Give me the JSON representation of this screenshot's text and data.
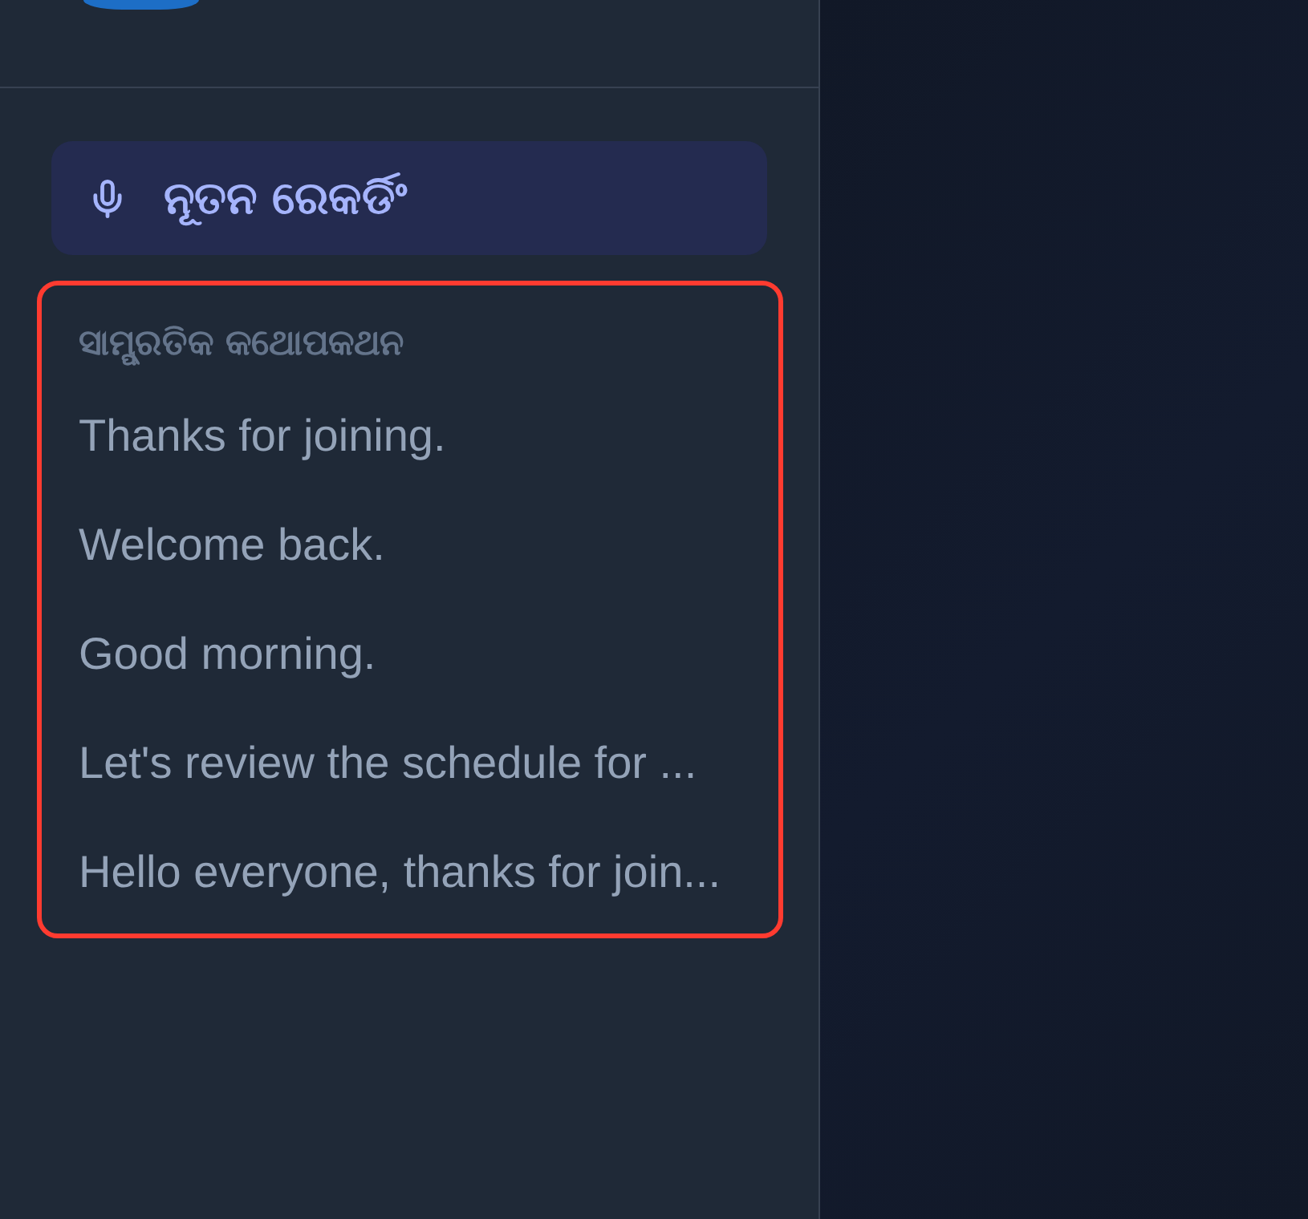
{
  "new_recording_button": {
    "label": "ନୂତନ ରେକର୍ଡିଂ"
  },
  "recent_conversations": {
    "highlighted": true,
    "heading": "ସାମ୍ପ୍ରତିକ କଥୋପକଥନ",
    "items": [
      {
        "title": "Thanks for joining."
      },
      {
        "title": "Welcome back."
      },
      {
        "title": "Good morning."
      },
      {
        "title": "Let's review the schedule for ..."
      },
      {
        "title": "Hello everyone, thanks for join..."
      }
    ]
  }
}
